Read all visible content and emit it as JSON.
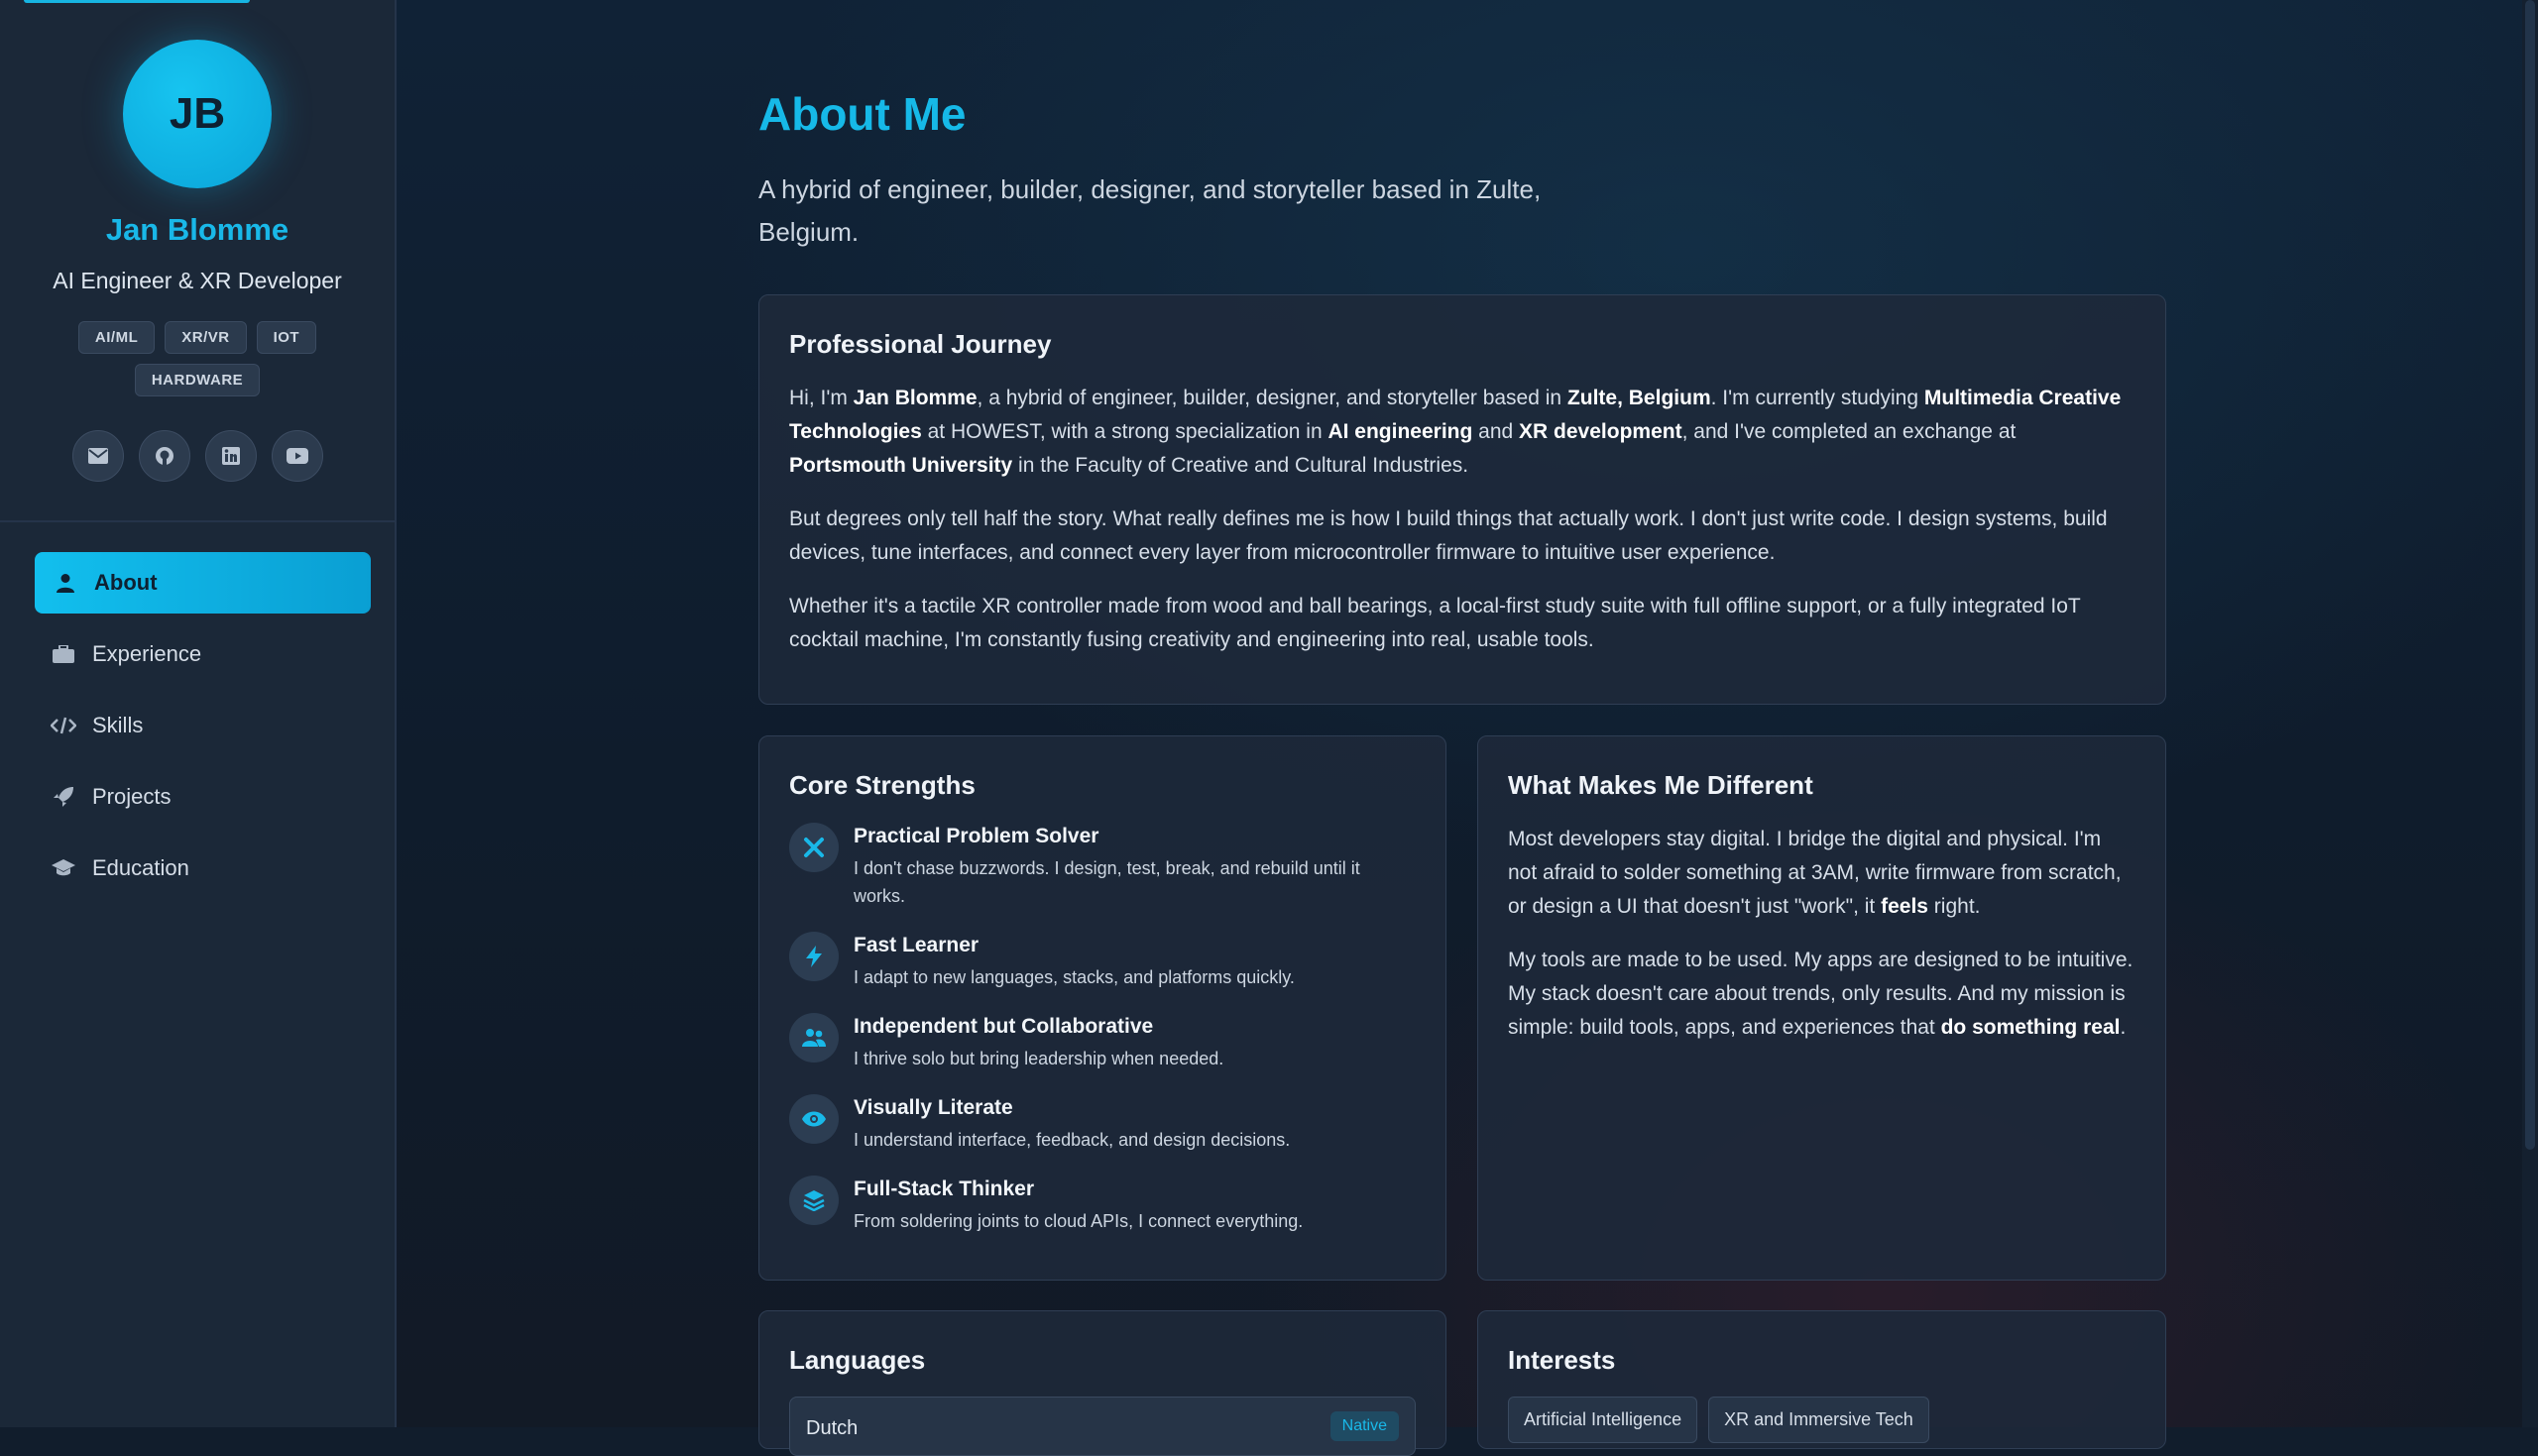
{
  "profile": {
    "initials": "JB",
    "name": "Jan Blomme",
    "role": "AI Engineer & XR Developer",
    "tags": [
      "AI/ML",
      "XR/VR",
      "IOT",
      "HARDWARE"
    ],
    "socials": [
      {
        "icon": "mail-icon"
      },
      {
        "icon": "github-icon"
      },
      {
        "icon": "linkedin-icon"
      },
      {
        "icon": "youtube-icon"
      }
    ]
  },
  "nav": {
    "items": [
      {
        "label": "About",
        "icon": "user-icon",
        "active": true
      },
      {
        "label": "Experience",
        "icon": "briefcase-icon"
      },
      {
        "label": "Skills",
        "icon": "code-icon"
      },
      {
        "label": "Projects",
        "icon": "rocket-icon"
      },
      {
        "label": "Education",
        "icon": "graduation-cap-icon"
      }
    ]
  },
  "main": {
    "title": "About Me",
    "subtitle": "A hybrid of engineer, builder, designer, and storyteller based in Zulte, Belgium.",
    "journey": {
      "heading": "Professional Journey",
      "p1": [
        {
          "t": "Hi, I'm "
        },
        {
          "t": "Jan Blomme",
          "b": true
        },
        {
          "t": ", a hybrid of engineer, builder, designer, and storyteller based in "
        },
        {
          "t": "Zulte, Belgium",
          "b": true
        },
        {
          "t": ". I'm currently studying "
        },
        {
          "t": "Multimedia Creative Technologies",
          "b": true
        },
        {
          "t": " at HOWEST, with a strong specialization in "
        },
        {
          "t": "AI engineering",
          "b": true
        },
        {
          "t": " and "
        },
        {
          "t": "XR development",
          "b": true
        },
        {
          "t": ", and I've completed an exchange at "
        },
        {
          "t": "Portsmouth University",
          "b": true
        },
        {
          "t": " in the Faculty of Creative and Cultural Industries."
        }
      ],
      "p2": "But degrees only tell half the story. What really defines me is how I build things that actually work. I don't just write code. I design systems, build devices, tune interfaces, and connect every layer from microcontroller firmware to intuitive user experience.",
      "p3": "Whether it's a tactile XR controller made from wood and ball bearings, a local-first study suite with full offline support, or a fully integrated IoT cocktail machine, I'm constantly fusing creativity and engineering into real, usable tools."
    },
    "strengths": {
      "heading": "Core Strengths",
      "items": [
        {
          "title": "Practical Problem Solver",
          "desc": "I don't chase buzzwords. I design, test, break, and rebuild until it works.",
          "icon": "tools-icon"
        },
        {
          "title": "Fast Learner",
          "desc": "I adapt to new languages, stacks, and platforms quickly.",
          "icon": "lightning-icon"
        },
        {
          "title": "Independent but Collaborative",
          "desc": "I thrive solo but bring leadership when needed.",
          "icon": "users-icon"
        },
        {
          "title": "Visually Literate",
          "desc": "I understand interface, feedback, and design decisions.",
          "icon": "eye-icon"
        },
        {
          "title": "Full-Stack Thinker",
          "desc": "From soldering joints to cloud APIs, I connect everything.",
          "icon": "layers-icon"
        }
      ]
    },
    "different": {
      "heading": "What Makes Me Different",
      "p1": [
        {
          "t": "Most developers stay digital. I bridge the digital and physical. I'm not afraid to solder something at 3AM, write firmware from scratch, or design a UI that doesn't just \"work\", it "
        },
        {
          "t": "feels",
          "b": true
        },
        {
          "t": " right."
        }
      ],
      "p2": [
        {
          "t": "My tools are made to be used. My apps are designed to be intuitive. My stack doesn't care about trends, only results. And my mission is simple: build tools, apps, and experiences that "
        },
        {
          "t": "do something real",
          "b": true
        },
        {
          "t": "."
        }
      ]
    },
    "languages": {
      "heading": "Languages",
      "items": [
        {
          "name": "Dutch",
          "level": "Native"
        }
      ]
    },
    "interests": {
      "heading": "Interests",
      "items": [
        "Artificial Intelligence",
        "XR and Immersive Tech"
      ]
    }
  },
  "colors": {
    "accent": "#17b9e8",
    "sidebar_bg": "#1b2838",
    "card_bg": "#1e293a",
    "page_bg": "#111d2c"
  }
}
